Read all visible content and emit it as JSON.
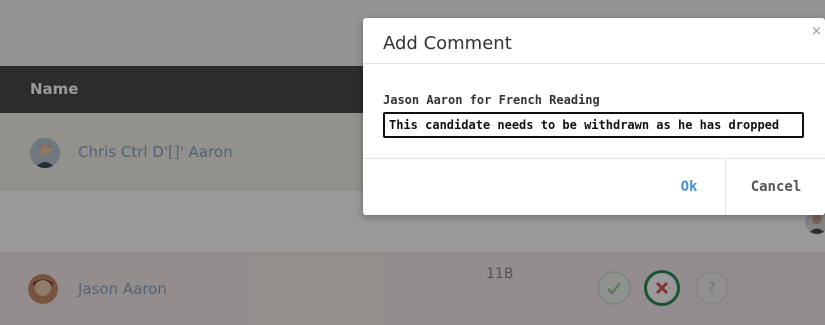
{
  "table": {
    "header_name": "Name",
    "rows": [
      {
        "name": "Chris Ctrl D'[]' Aaron"
      },
      {
        "name": "Jason Aaron",
        "group": "11B"
      }
    ]
  },
  "modal": {
    "title": "Add Comment",
    "close_glyph": "×",
    "label": "Jason Aaron for French Reading",
    "comment_value": "This candidate needs to be withdrawn as he has dropped",
    "ok_label": "Ok",
    "cancel_label": "Cancel"
  },
  "colors": {
    "header_bg": "#4a4a4a",
    "name_link": "#8aa6c6",
    "ok_accent": "#4a90d9",
    "absent_red": "#d9534f",
    "present_green": "#9ec79e"
  },
  "icons": {
    "present": "check-icon",
    "absent": "cross-icon",
    "unknown": "question-icon"
  }
}
